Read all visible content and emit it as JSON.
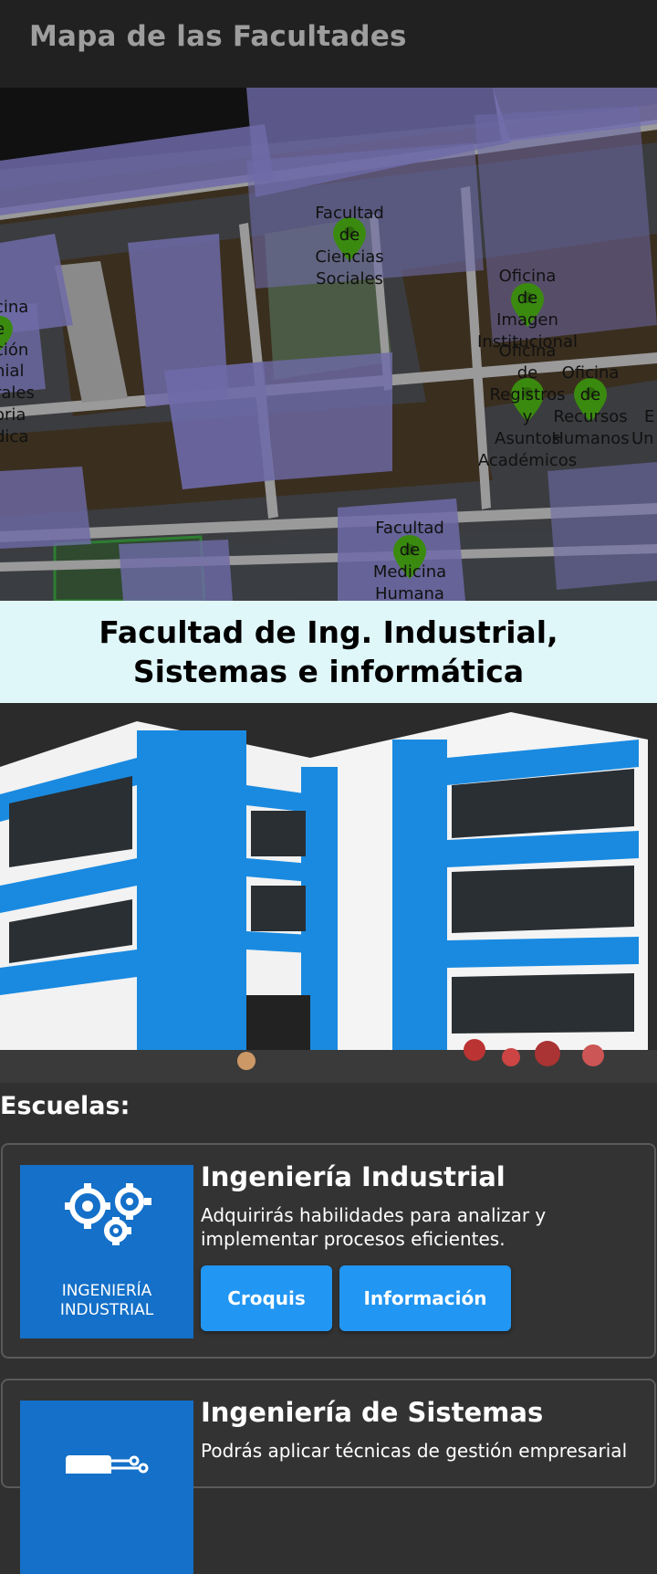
{
  "appbar": {
    "title": "Mapa de las Facultades"
  },
  "map": {
    "markers": [
      {
        "name": "facultad-ciencias-sociales",
        "lines": [
          "Facultad",
          "de",
          "Ciencias",
          "Sociales"
        ]
      },
      {
        "name": "oficina-imagen-institucional",
        "lines": [
          "Oficina",
          "de",
          "Imagen",
          "Institucional"
        ]
      },
      {
        "name": "oficina-registros-asuntos-academicos",
        "lines": [
          "Oficina",
          "de",
          "Registros",
          "y",
          "Asuntos",
          "Académicos"
        ]
      },
      {
        "name": "oficina-recursos-humanos",
        "lines": [
          "Oficina",
          "de",
          "Recursos",
          "Humanos"
        ]
      },
      {
        "name": "facultad-medicina-humana",
        "lines": [
          "Facultad",
          "de",
          "Medicina",
          "Humana"
        ]
      }
    ],
    "edge_label_left": [
      "cina",
      "e",
      "cia",
      "ción",
      "e",
      "nial",
      "dios",
      "e",
      "rales",
      "oria",
      "dica"
    ],
    "edge_label_right": [
      "E",
      "Un"
    ],
    "colors": {
      "pin": "#3a8a0f",
      "building": "#6e6aa8",
      "road": "#9a9a9a",
      "block": "#3a2e1e"
    }
  },
  "banner": {
    "title": "Facultad de Ing. Industrial, Sistemas e informática"
  },
  "photo": {
    "alt": "building-photo"
  },
  "schools": {
    "label": "Escuelas:",
    "items": [
      {
        "title": "Ingeniería Industrial",
        "description": "Adquirirás habilidades para analizar y implementar procesos eficientes.",
        "thumb_caption_1": "INGENIERÍA",
        "thumb_caption_2": "INDUSTRIAL",
        "btn_croquis": "Croquis",
        "btn_info": "Información"
      },
      {
        "title": "Ingeniería de Sistemas",
        "description": "Podrás aplicar técnicas de gestión empresarial"
      }
    ]
  }
}
